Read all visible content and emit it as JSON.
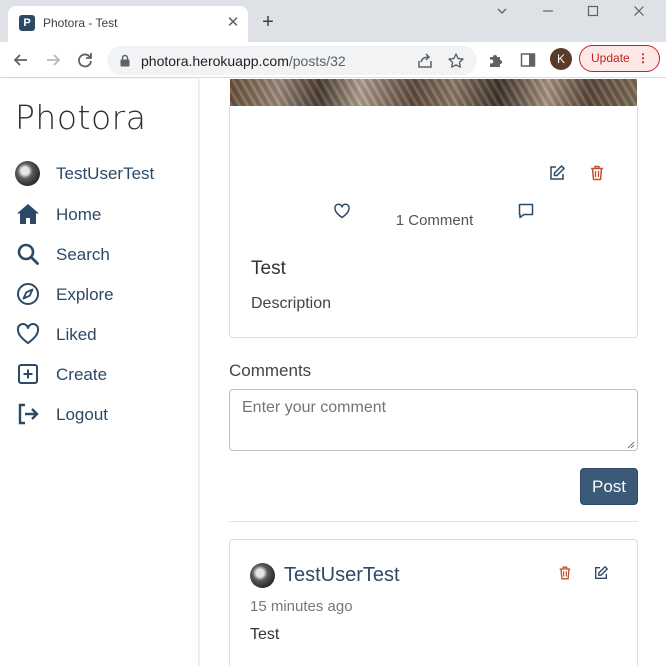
{
  "browser": {
    "tab_title": "Photora - Test",
    "favicon_letter": "P",
    "close_glyph": "✕",
    "newtab_glyph": "+",
    "url_host": "photora.herokuapp.com",
    "url_path": "/posts/32",
    "profile_letter": "K",
    "update_label": "Update",
    "menu_glyph": "⋮"
  },
  "sidebar": {
    "logo": "Photora",
    "items": [
      {
        "label": "TestUserTest",
        "icon": "user-avatar"
      },
      {
        "label": "Home",
        "icon": "home-icon"
      },
      {
        "label": "Search",
        "icon": "search-icon"
      },
      {
        "label": "Explore",
        "icon": "compass-icon"
      },
      {
        "label": "Liked",
        "icon": "heart-icon"
      },
      {
        "label": "Create",
        "icon": "plus-square-icon"
      },
      {
        "label": "Logout",
        "icon": "logout-icon"
      }
    ]
  },
  "post": {
    "comment_count": "1 Comment",
    "title": "Test",
    "description": "Description"
  },
  "comments": {
    "heading": "Comments",
    "input_placeholder": "Enter your comment",
    "post_button": "Post",
    "items": [
      {
        "user": "TestUserTest",
        "time": "15 minutes ago",
        "text": "Test"
      }
    ]
  },
  "colors": {
    "brand": "#2c4a66",
    "delete": "#c0522f",
    "post_button": "#3b5a78"
  }
}
